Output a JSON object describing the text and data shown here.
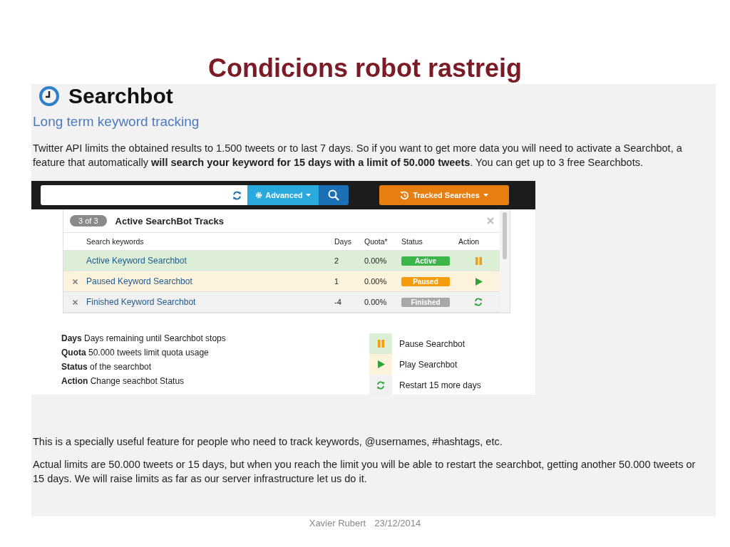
{
  "slide_title": "Condicions robot rastreig",
  "app": {
    "name": "Searchbot",
    "subtitle": "Long term keyword tracking",
    "intro": "Twitter API limits the obtained results to 1.500 tweets or to last 7 days. So if you want to get more data you will need to activate a Searchbot, a feature that automatically **will search your keyword for 15 days with a limit of 50.000 tweets**. You can get up to 3 free Searchbots.",
    "toolbar": {
      "advanced_button": "Advanced",
      "tracked_button": "Tracked Searches"
    },
    "tracks_panel": {
      "count_badge": "3 of 3",
      "title": "Active SearchBot Tracks",
      "columns": [
        "Search keywords",
        "Days",
        "Quota*",
        "Status",
        "Action"
      ],
      "rows": [
        {
          "kind": "active",
          "keyword": "Active Keyword Searchbot",
          "days": "2",
          "quota": "0.00%",
          "status": "Active"
        },
        {
          "kind": "paused",
          "keyword": "Paused Keyword Searchbot",
          "days": "1",
          "quota": "0.00%",
          "status": "Paused"
        },
        {
          "kind": "finished",
          "keyword": "Finished Keyword Searchbot",
          "days": "-4",
          "quota": "0.00%",
          "status": "Finished"
        }
      ]
    },
    "legend_terms": [
      "**Days**  Days remaining until Searchbot stops",
      "**Quota** 50.000 tweets limit quota usage",
      "**Status** of the searchbot",
      "**Action** Change seachbot Status"
    ],
    "legend_actions": [
      {
        "kind": "pause",
        "label": "Pause Searchbot"
      },
      {
        "kind": "play",
        "label": "Play Searchbot"
      },
      {
        "kind": "restart",
        "label": "Restart 15 more days"
      }
    ],
    "notes": [
      "This is a specially useful feature for people who need to track keywords, @usernames, #hashtags, etc.",
      "Actual limits are 50.000 tweets or 15 days, but when you reach the limit you will be able to restart the searchbot, getting another 50.000 tweets or 15 days. We will raise limits as far as our server infrastructure let us do it."
    ]
  },
  "footer": {
    "author": "Xavier Rubert",
    "date": "23/12/2014"
  }
}
